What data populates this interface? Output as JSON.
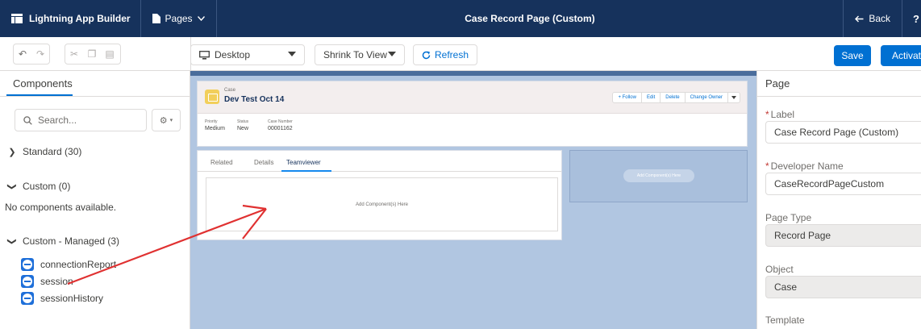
{
  "topbar": {
    "app_name": "Lightning App Builder",
    "pages_label": "Pages",
    "title": "Case Record Page (Custom)",
    "back_label": "Back",
    "help_label": "?"
  },
  "toolbar": {
    "device_value": "Desktop",
    "zoom_value": "Shrink To View",
    "refresh_label": "Refresh",
    "save_label": "Save",
    "activate_label": "Activation..."
  },
  "left_panel": {
    "tab_label": "Components",
    "search_placeholder": "Search...",
    "standard_label": "Standard (30)",
    "custom_label": "Custom (0)",
    "no_components": "No components available.",
    "custom_managed_label": "Custom - Managed (3)",
    "items": [
      {
        "label": "connectionReport"
      },
      {
        "label": "session"
      },
      {
        "label": "sessionHistory"
      }
    ]
  },
  "canvas": {
    "record": {
      "object_label": "Case",
      "title": "Dev Test Oct 14",
      "actions": [
        "+ Follow",
        "Edit",
        "Delete",
        "Change Owner"
      ],
      "fields": [
        {
          "label": "Priority",
          "value": "Medium"
        },
        {
          "label": "Status",
          "value": "New"
        },
        {
          "label": "Case Number",
          "value": "00001162"
        }
      ]
    },
    "tabs": [
      "Related",
      "Details",
      "Teamviewer"
    ],
    "active_tab": "Teamviewer",
    "dropzone_text": "Add Component(s) Here",
    "side_zone_text": "Add Component(s) Here"
  },
  "right_panel": {
    "title": "Page",
    "label_field": {
      "label": "Label",
      "value": "Case Record Page (Custom)"
    },
    "dev_name_field": {
      "label": "Developer Name",
      "value": "CaseRecordPageCustom"
    },
    "page_type_field": {
      "label": "Page Type",
      "value": "Record Page"
    },
    "object_field": {
      "label": "Object",
      "value": "Case"
    },
    "template_label": "Template"
  },
  "colors": {
    "topbar": "#16325c",
    "brand": "#0070d2",
    "canvas": "#b1c6e1",
    "annotation_arrow": "#e03131"
  }
}
